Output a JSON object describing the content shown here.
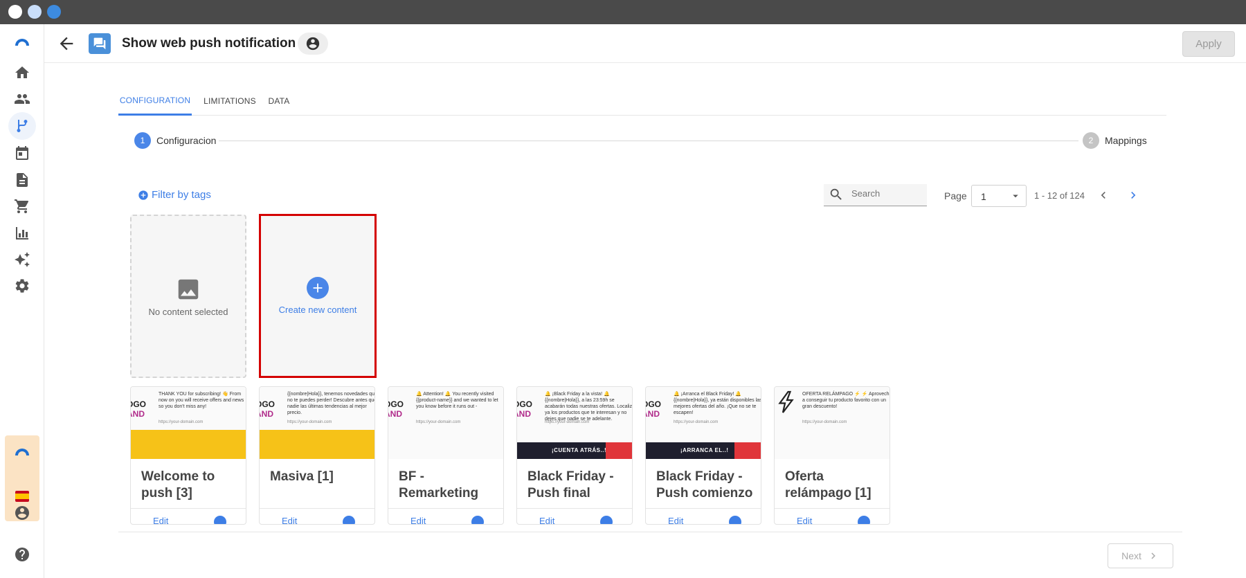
{
  "window": {
    "dots": [
      "#ffffff",
      "#c9defa",
      "#3d8be0"
    ]
  },
  "sidebar": {
    "items": [
      {
        "name": "home-icon"
      },
      {
        "name": "people-icon"
      },
      {
        "name": "flow-icon",
        "active": true
      },
      {
        "name": "calendar-icon"
      },
      {
        "name": "document-icon"
      },
      {
        "name": "cart-icon"
      },
      {
        "name": "bar-chart-icon"
      },
      {
        "name": "sparkle-icon"
      },
      {
        "name": "gear-icon"
      }
    ]
  },
  "header": {
    "title": "Show web push notification",
    "apply_label": "Apply"
  },
  "tabs": [
    {
      "label": "CONFIGURATION",
      "active": true
    },
    {
      "label": "LIMITATIONS",
      "active": false
    },
    {
      "label": "DATA",
      "active": false
    }
  ],
  "stepper": {
    "steps": [
      {
        "number": "1",
        "label": "Configuracion",
        "active": true
      },
      {
        "number": "2",
        "label": "Mappings",
        "active": false
      }
    ]
  },
  "toolbar": {
    "filter_label": "Filter by tags",
    "search_placeholder": "Search",
    "page_label": "Page",
    "page_value": "1",
    "range_text": "1 - 12 of 124"
  },
  "empty_card": {
    "label": "No content selected"
  },
  "new_card": {
    "label": "Create new content"
  },
  "templates": [
    {
      "title": "Welcome to push [3]",
      "logo1": "OGO",
      "logo2": "AND",
      "preview": "THANK YOU for subscribing! 👋 From now on you will receive offers and news so you don't miss any!",
      "url": "https://your-domain.com",
      "image": "yellow",
      "banner": ""
    },
    {
      "title": "Masiva [1]",
      "logo1": "OGO",
      "logo2": "AND",
      "preview": "{{nombre|Hola}}, tenemos novedades que no te puedes perder! Descubre antes que nadie las últimas tendencias al mejor precio.",
      "url": "https://your-domain.com",
      "image": "yellow",
      "banner": ""
    },
    {
      "title": "BF - Remarketing",
      "logo1": "OGO",
      "logo2": "AND",
      "preview": "🔔 Attention! 🔔 You recently visited {{product-name}} and we wanted to let you know before it runs out -",
      "url": "https://your-domain.com",
      "image": "none",
      "banner": ""
    },
    {
      "title": "Black Friday - Push final",
      "logo1": "OGO",
      "logo2": "AND",
      "preview": "🔔 ¡Black Friday a la vista! 🔔 {{nombre|Hola}}, a las 23:59h se acabarán todas nuestras ofertas. Localiza ya los productos que te interesan y no dejes que nadie se te adelante.",
      "url": "https://your-domain.com",
      "image": "dark",
      "banner": "¡CUENTA ATRÁS..!"
    },
    {
      "title": "Black Friday - Push comienzo",
      "logo1": "OGO",
      "logo2": "AND",
      "preview": "🔔 ¡Arranca el Black Friday! 🔔 {{nombre|Hola}}, ya están disponibles las mejores ofertas del año. ¡Que no se te escapen!",
      "url": "https://your-domain.com",
      "image": "dark",
      "banner": "¡ARRANCA EL..!"
    },
    {
      "title": "Oferta relámpago [1]",
      "logo1": "",
      "logo2": "",
      "preview": "OFERTA RELÁMPAGO ⚡ ⚡ Aprovecha a conseguir tu producto favorito con un gran descuento!",
      "url": "https://your-domain.com",
      "image": "none",
      "banner": ""
    }
  ],
  "card_actions": {
    "edit_label": "Edit"
  },
  "footer": {
    "next_label": "Next"
  },
  "colors": {
    "accent": "#3d7ee6",
    "highlight_border": "#d40000"
  }
}
